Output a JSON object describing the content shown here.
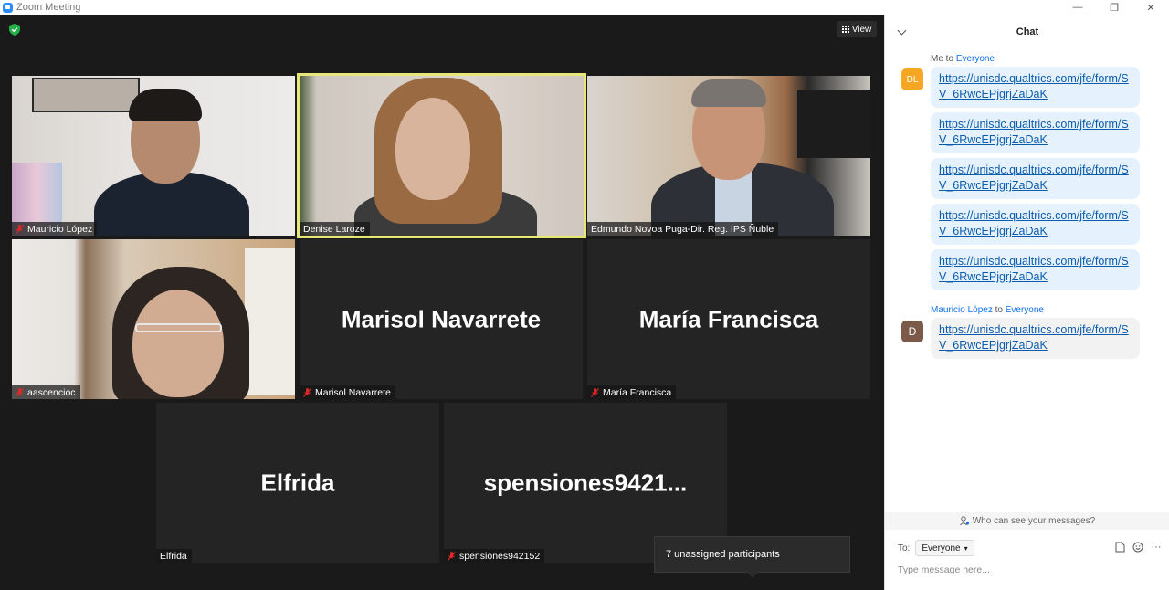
{
  "window": {
    "title": "Zoom Meeting",
    "minimize": "—",
    "restore": "❐",
    "close": "✕"
  },
  "toolbar": {
    "view_label": "View"
  },
  "tiles": [
    {
      "name": "Mauricio López",
      "big_name": "",
      "muted": true
    },
    {
      "name": "Denise Laroze",
      "big_name": "",
      "muted": false
    },
    {
      "name": "Edmundo Novoa Puga-Dir. Reg. IPS Ñuble",
      "big_name": "",
      "muted": false
    },
    {
      "name": "aascencioc",
      "big_name": "",
      "muted": true
    },
    {
      "name": "Marisol Navarrete",
      "big_name": "Marisol Navarrete",
      "muted": true
    },
    {
      "name": "María Francisca",
      "big_name": "María Francisca",
      "muted": true
    },
    {
      "name": "Elfrida",
      "big_name": "Elfrida",
      "muted": false
    },
    {
      "name": "spensiones942152",
      "big_name": "spensiones9421...",
      "muted": true
    }
  ],
  "tooltip": {
    "text": "7 unassigned participants"
  },
  "chat": {
    "title": "Chat",
    "groups": [
      {
        "from": "Me",
        "connector": " to ",
        "to": "Everyone",
        "avatar_initials": "DL",
        "avatar_color": "#f5a623",
        "messages": [
          "https://unisdc.qualtrics.com/jfe/form/SV_6RwcEPjgrjZaDaK",
          "https://unisdc.qualtrics.com/jfe/form/SV_6RwcEPjgrjZaDaK",
          "https://unisdc.qualtrics.com/jfe/form/SV_6RwcEPjgrjZaDaK",
          "https://unisdc.qualtrics.com/jfe/form/SV_6RwcEPjgrjZaDaK",
          "https://unisdc.qualtrics.com/jfe/form/SV_6RwcEPjgrjZaDaK"
        ]
      },
      {
        "from": "Mauricio López",
        "connector": " to ",
        "to": "Everyone",
        "avatar_initials": "D",
        "avatar_color": "#7b5a4a",
        "messages": [
          "https://unisdc.qualtrics.com/jfe/form/SV_6RwcEPjgrjZaDaK"
        ]
      }
    ],
    "who_can_see": "Who can see your messages?",
    "to_label": "To:",
    "to_value": "Everyone",
    "input_placeholder": "Type message here..."
  },
  "colors": {
    "accent": "#0e71eb",
    "active_speaker": "#e6e679",
    "muted_red": "#e02828"
  }
}
